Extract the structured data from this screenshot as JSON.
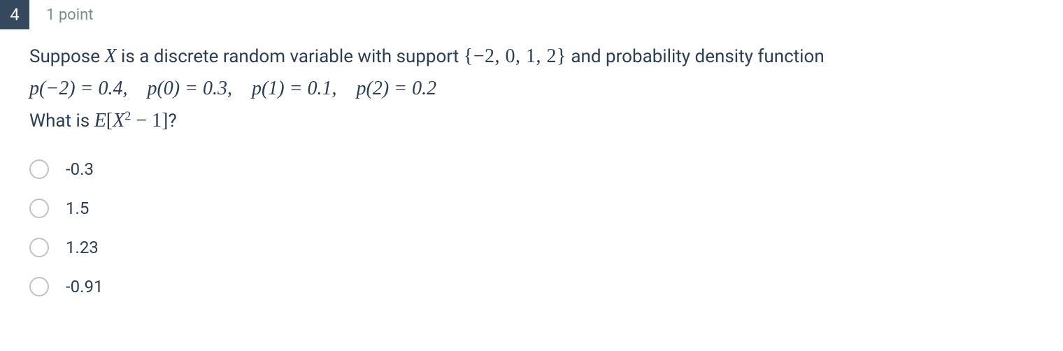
{
  "question": {
    "number": "4",
    "points": "1 point",
    "intro_prefix": "Suppose ",
    "intro_var": "X",
    "intro_middle": " is a discrete random variable with support ",
    "support_set": "{−2, 0, 1, 2}",
    "intro_suffix": " and probability density function",
    "pdf_line": "p(−2) = 0.4,    p(0) = 0.3,    p(1) = 0.1,    p(2) = 0.2",
    "ask_prefix": "What is ",
    "ask_expr_E": "E",
    "ask_expr_open": "[",
    "ask_expr_var": "X",
    "ask_expr_pow": "2",
    "ask_expr_rest": " − 1]",
    "ask_suffix": "?"
  },
  "options": [
    {
      "label": "-0.3"
    },
    {
      "label": "1.5"
    },
    {
      "label": "1.23"
    },
    {
      "label": "-0.91"
    }
  ]
}
